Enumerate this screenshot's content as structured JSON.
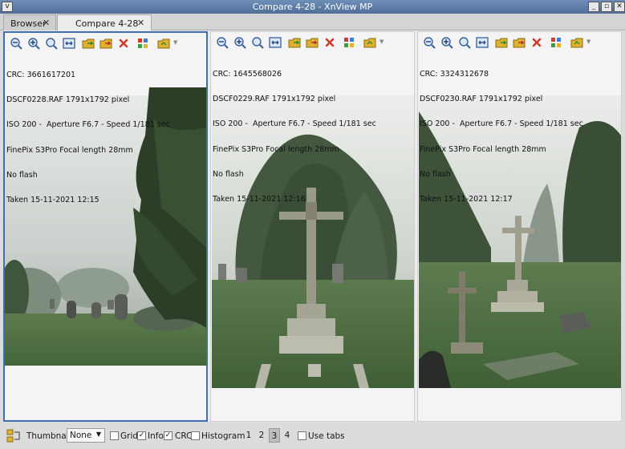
{
  "window": {
    "title": "Compare 4-28 - XnView MP",
    "sysmenu_glyph": "v",
    "minimize_glyph": "_",
    "maximize_glyph": "▫",
    "close_glyph": "✕"
  },
  "tabs": [
    {
      "label": "Browser",
      "close": "✕",
      "active": false
    },
    {
      "label": "Compare 4-28",
      "close": "✕",
      "active": true
    }
  ],
  "toolbar_icons": [
    "zoom-out-icon",
    "zoom-in-icon",
    "zoom-reset-icon",
    "fit-window-icon",
    "copy-to-folder-icon",
    "move-to-folder-icon",
    "delete-icon",
    "settings-icon",
    "open-folder-icon"
  ],
  "panes": [
    {
      "crc": "CRC: 3661617201",
      "file": "DSCF0228.RAF 1791x1792 pixel",
      "exposure": "ISO 200 -  Aperture F6.7 - Speed 1/181 sec",
      "camera": "FinePix S3Pro Focal length 28mm",
      "flash": "No flash",
      "taken": "Taken 15-11-2021 12:15",
      "selected": true
    },
    {
      "crc": "CRC: 1645568026",
      "file": "DSCF0229.RAF 1791x1792 pixel",
      "exposure": "ISO 200 -  Aperture F6.7 - Speed 1/181 sec",
      "camera": "FinePix S3Pro Focal length 28mm",
      "flash": "No flash",
      "taken": "Taken 15-11-2021 12:16",
      "selected": false
    },
    {
      "crc": "CRC: 3324312678",
      "file": "DSCF0230.RAF 1791x1792 pixel",
      "exposure": "ISO 200 -  Aperture F6.7 - Speed 1/181 sec",
      "camera": "FinePix S3Pro Focal length 28mm",
      "flash": "No flash",
      "taken": "Taken 15-11-2021 12:17",
      "selected": false
    }
  ],
  "bottom": {
    "thumbnails_label": "Thumbnails",
    "thumbnails_value": "None",
    "grid_label": "Grid",
    "grid_checked": false,
    "info_label": "Info",
    "info_checked": true,
    "crc_label": "CRC",
    "crc_checked": true,
    "histogram_label": "Histogram",
    "histogram_checked": false,
    "pages": [
      "1",
      "2",
      "3",
      "4"
    ],
    "current_page": "3",
    "use_tabs_label": "Use tabs",
    "use_tabs_checked": false,
    "checkmark": "✓"
  },
  "colors": {
    "selection_border": "#3f6fb0",
    "delete_icon": "#d03a2a",
    "folder_icon": "#e0b030"
  }
}
